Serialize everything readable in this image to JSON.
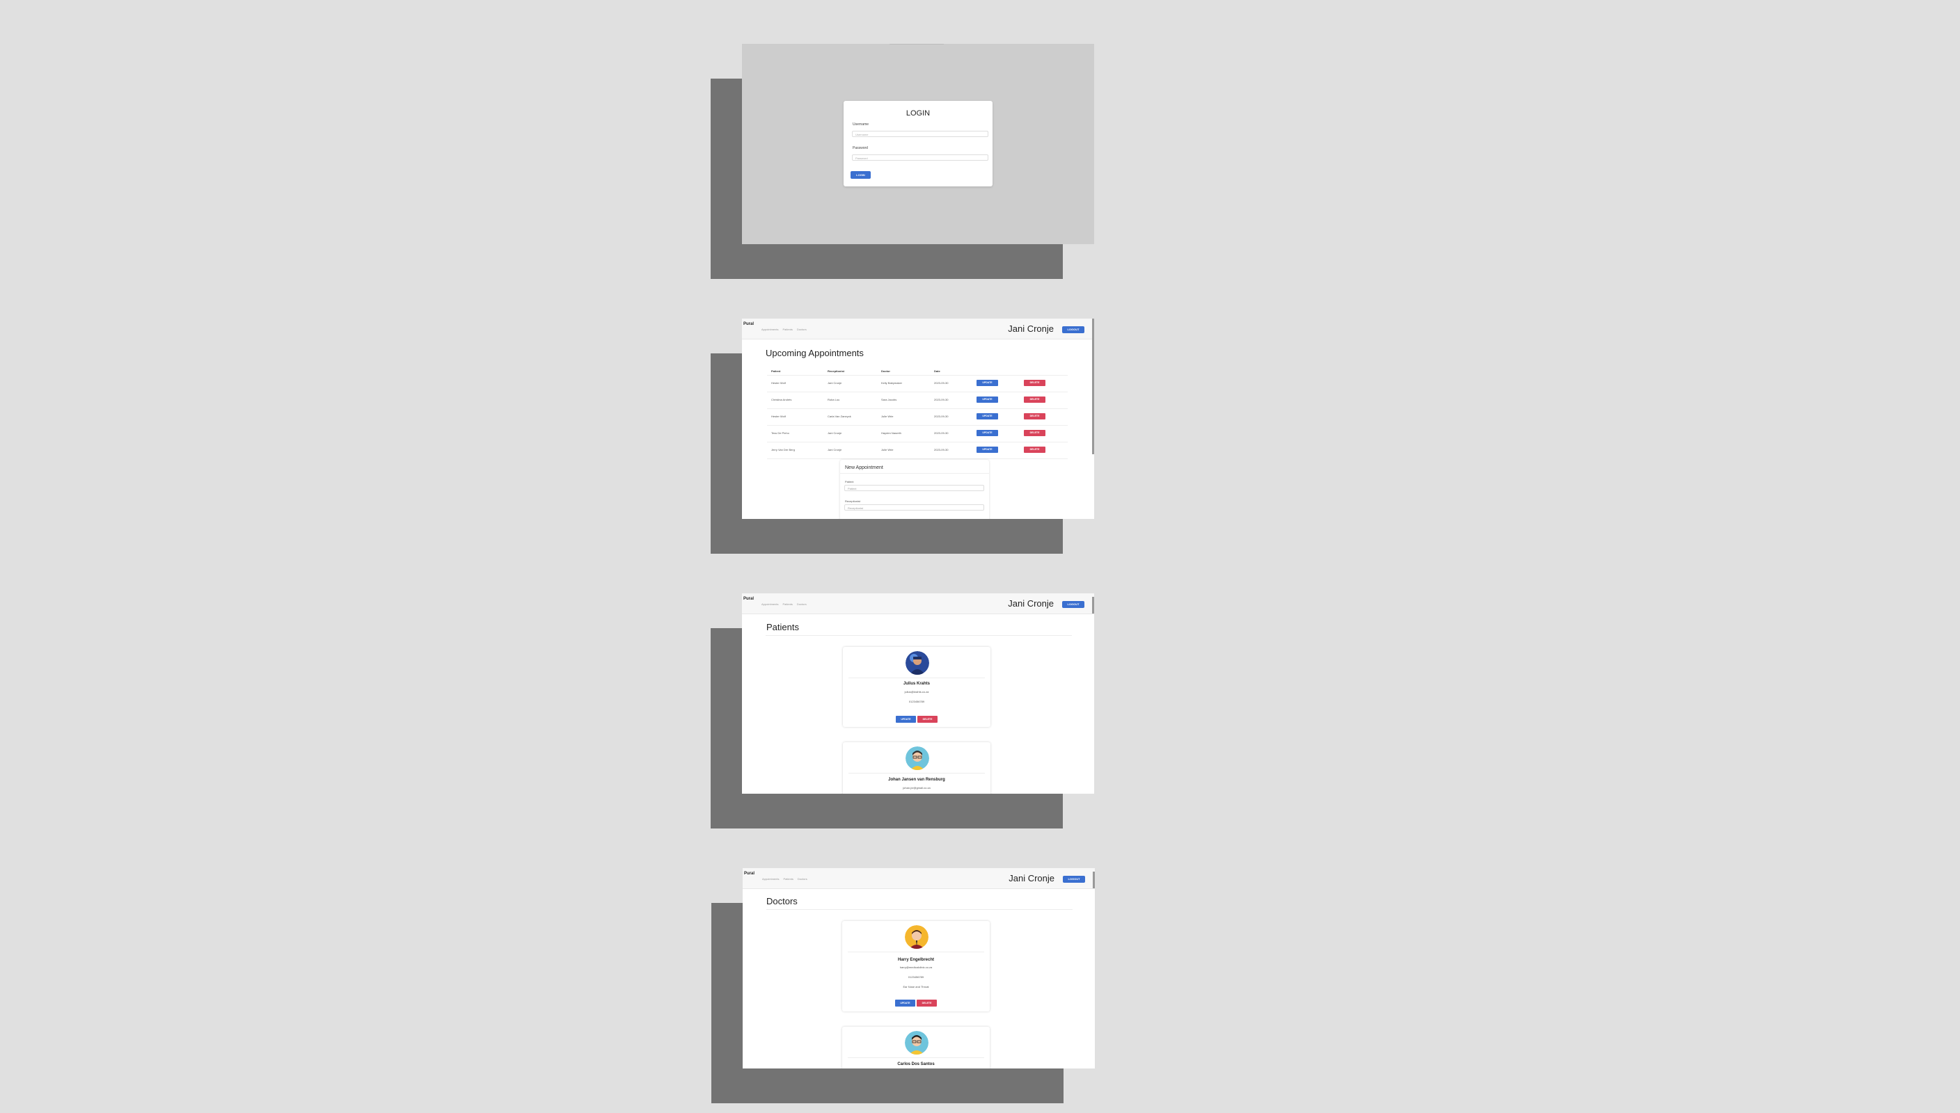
{
  "login": {
    "title": "LOGIN",
    "username_label": "Username",
    "username_placeholder": "Username",
    "password_label": "Password",
    "password_placeholder": "Password",
    "button": "LOGIN"
  },
  "nav": {
    "brand": "Pural",
    "links": [
      "Appointments",
      "Patients",
      "Doctors"
    ],
    "user": "Jani Cronje",
    "logout": "LOGOUT"
  },
  "appointments": {
    "title": "Upcoming Appointments",
    "headers": [
      "Patient",
      "Receptionist",
      "Doctor",
      "Date"
    ],
    "rows": [
      [
        "Hester Wolf",
        "Jani Cronje",
        "Kelly Babymaker",
        "2023-09-30"
      ],
      [
        "Christina Andrés",
        "Ruba Lou",
        "Sara Jacobs",
        "2023-09-30"
      ],
      [
        "Hester Wolf",
        "Carla Van Zaneyck",
        "Julie Wrie",
        "2023-09-30"
      ],
      [
        "Tess De Pinho",
        "Jani Cronje",
        "Hayden Nasreth",
        "2023-09-30"
      ],
      [
        "Jerry Van Der Berg",
        "Jani Cronje",
        "Julie Wrie",
        "2023-09-30"
      ]
    ],
    "update": "UPDATE",
    "delete": "DELETE",
    "new_title": "New Appointment",
    "patient_label": "Patient",
    "patient_value": "Patient",
    "receptionist_label": "Receptionist",
    "receptionist_value": "Receptionist"
  },
  "patients": {
    "title": "Patients",
    "items": [
      {
        "name": "Julius Krahts",
        "email": "julius@krahts.co.za",
        "phone": "0123456789"
      },
      {
        "name": "Johan Jansen van Rensburg",
        "email": "johan.jvr@gmail.co.za"
      }
    ],
    "update": "UPDATE",
    "delete": "DELETE"
  },
  "doctors": {
    "title": "Doctors",
    "items": [
      {
        "name": "Harry Engelbrecht",
        "email": "harry@medicalclinic.co.za",
        "phone": "0123456789",
        "specialty": "Ear Nose and Throat"
      },
      {
        "name": "Carlos Dos Santos"
      }
    ],
    "update": "UPDATE",
    "delete": "DELETE"
  },
  "colors": {
    "primary": "#3a6fd0",
    "danger": "#d9435a",
    "background": "#e0e0e0",
    "shadow": "#737373"
  }
}
